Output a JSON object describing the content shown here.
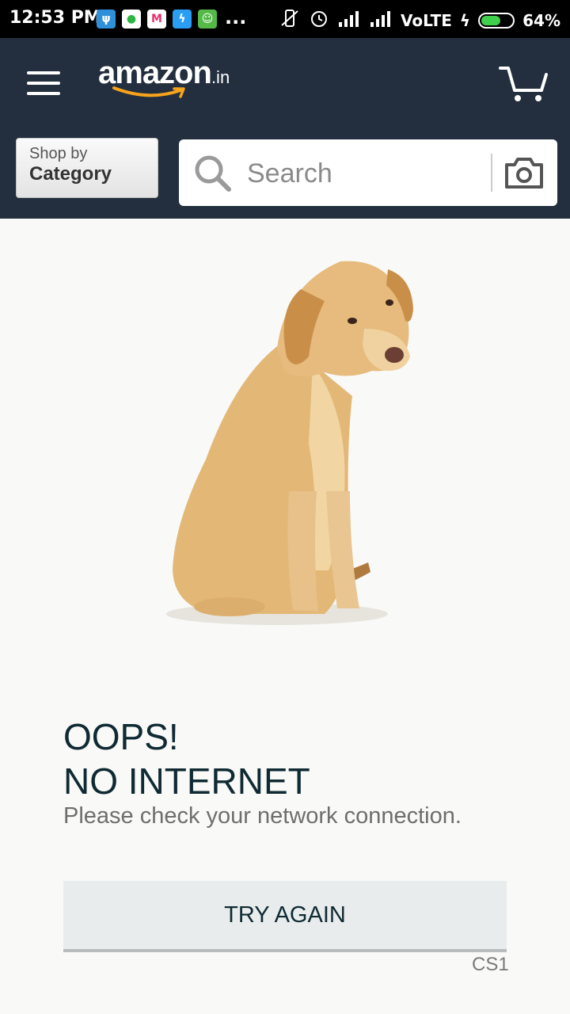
{
  "status_bar": {
    "time": "12:53 PM",
    "more": "...",
    "network": "VoLTE",
    "battery_text": "64%",
    "battery_level": 0.64,
    "app_icons": [
      "telegram-icon",
      "whatsapp-icon",
      "myntra-icon",
      "bolt-icon",
      "frog-app-icon"
    ]
  },
  "header": {
    "logo_main": "amazon",
    "logo_suffix": ".in",
    "background_color": "#232f3e",
    "shop_by_line1": "Shop by",
    "shop_by_line2": "Category",
    "search_placeholder": "Search"
  },
  "error": {
    "title_line1": "OOPS!",
    "title_line2": "NO INTERNET",
    "message": "Please check your network connection.",
    "button_label": "TRY AGAIN",
    "code": "CS1"
  }
}
